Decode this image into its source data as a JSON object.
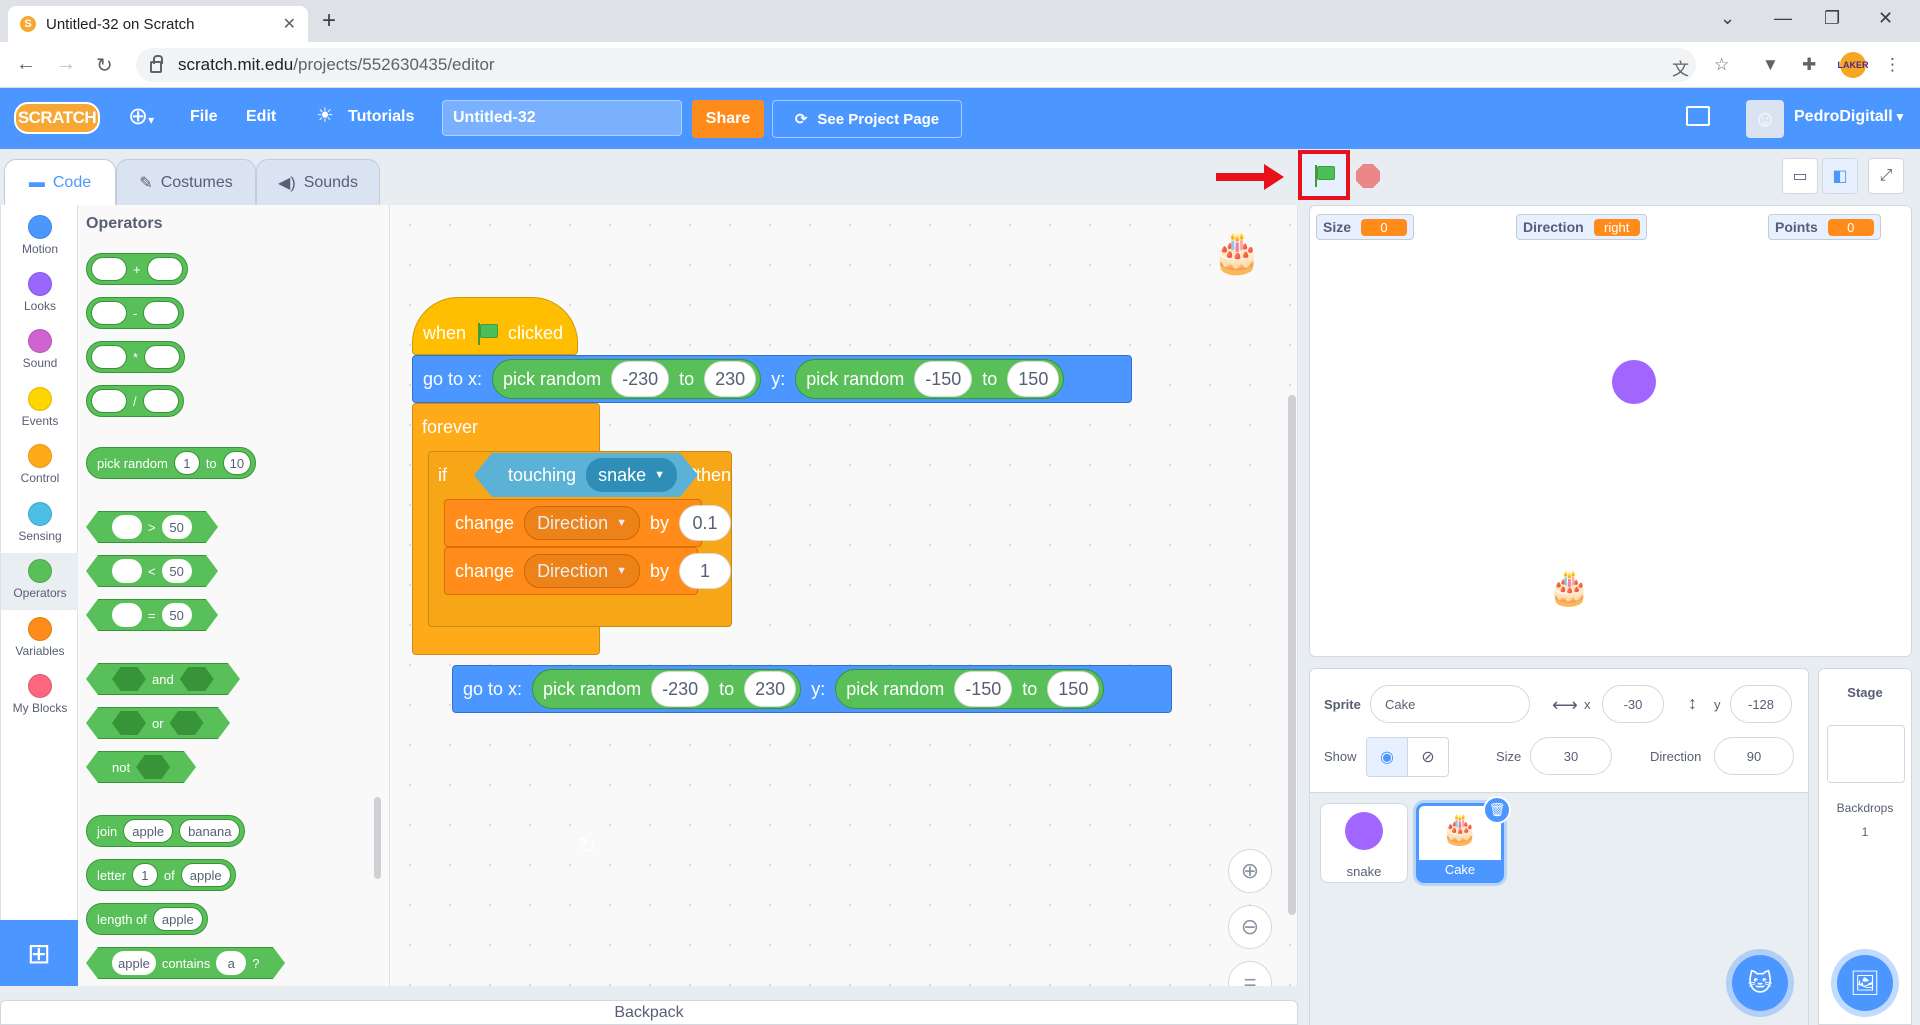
{
  "browser": {
    "tab_title": "Untitled-32 on Scratch",
    "tab_close": "✕",
    "new_tab": "+",
    "url_host": "scratch.mit.edu",
    "url_path": "/projects/552630435/editor",
    "ext_avatar_text": "LAKER"
  },
  "menubar": {
    "logo": "SCRATCH",
    "file": "File",
    "edit": "Edit",
    "tutorials": "Tutorials",
    "project_title": "Untitled-32",
    "share": "Share",
    "see_project_page": "See Project Page",
    "username": "PedroDigitall"
  },
  "editor_tabs": {
    "code": "Code",
    "costumes": "Costumes",
    "sounds": "Sounds"
  },
  "categories": [
    {
      "label": "Motion",
      "color": "#4c97ff"
    },
    {
      "label": "Looks",
      "color": "#9966ff"
    },
    {
      "label": "Sound",
      "color": "#cf63cf"
    },
    {
      "label": "Events",
      "color": "#ffd500"
    },
    {
      "label": "Control",
      "color": "#ffab19"
    },
    {
      "label": "Sensing",
      "color": "#4cbfe6"
    },
    {
      "label": "Operators",
      "color": "#59c059"
    },
    {
      "label": "Variables",
      "color": "#ff8c1a"
    },
    {
      "label": "My Blocks",
      "color": "#ff6680"
    }
  ],
  "palette": {
    "title": "Operators",
    "add": "+",
    "subtract": "-",
    "multiply": "*",
    "divide": "/",
    "pick_random": {
      "label": "pick random",
      "from": "1",
      "to_label": "to",
      "to": "10"
    },
    "gt": {
      "op": ">",
      "value": "50"
    },
    "lt": {
      "op": "<",
      "value": "50"
    },
    "eq": {
      "op": "=",
      "value": "50"
    },
    "and": "and",
    "or": "or",
    "not": "not",
    "join": {
      "label": "join",
      "a": "apple",
      "b": "banana"
    },
    "letter": {
      "label": "letter",
      "index": "1",
      "of": "of",
      "word": "apple"
    },
    "length": {
      "label": "length of",
      "word": "apple"
    },
    "contains": {
      "word": "apple",
      "label": "contains",
      "letter": "a",
      "q": "?"
    }
  },
  "script": {
    "when_flag": {
      "when": "when",
      "clicked": "clicked"
    },
    "goto1": {
      "label": "go to x:",
      "rand": "pick random",
      "x_from": "-230",
      "to": "to",
      "x_to": "230",
      "y": "y:",
      "y_from": "-150",
      "y_to": "150"
    },
    "forever": "forever",
    "if": {
      "label": "if",
      "touching": "touching",
      "target": "snake",
      "q": "?",
      "then": "then"
    },
    "change1": {
      "label": "change",
      "var": "Direction",
      "by": "by",
      "value": "0.1"
    },
    "change2": {
      "label": "change",
      "var": "Direction",
      "by": "by",
      "value": "1"
    },
    "goto2": {
      "label": "go to x:",
      "rand": "pick random",
      "x_from": "-230",
      "to": "to",
      "x_to": "230",
      "y": "y:",
      "y_from": "-150",
      "y_to": "150"
    },
    "loop_arrow": "↻"
  },
  "stage": {
    "monitors": [
      {
        "label": "Size",
        "value": "0"
      },
      {
        "label": "Direction",
        "value": "right"
      },
      {
        "label": "Points",
        "value": "0"
      }
    ]
  },
  "sprite_info": {
    "sprite_label": "Sprite",
    "sprite_name": "Cake",
    "x_label": "x",
    "x": "-30",
    "y_label": "y",
    "y": "-128",
    "show_label": "Show",
    "size_label": "Size",
    "size": "30",
    "direction_label": "Direction",
    "direction": "90"
  },
  "sprites": [
    {
      "name": "snake"
    },
    {
      "name": "Cake"
    }
  ],
  "stage_pane": {
    "title": "Stage",
    "backdrops_label": "Backdrops",
    "backdrops_count": "1"
  },
  "backpack": "Backpack"
}
